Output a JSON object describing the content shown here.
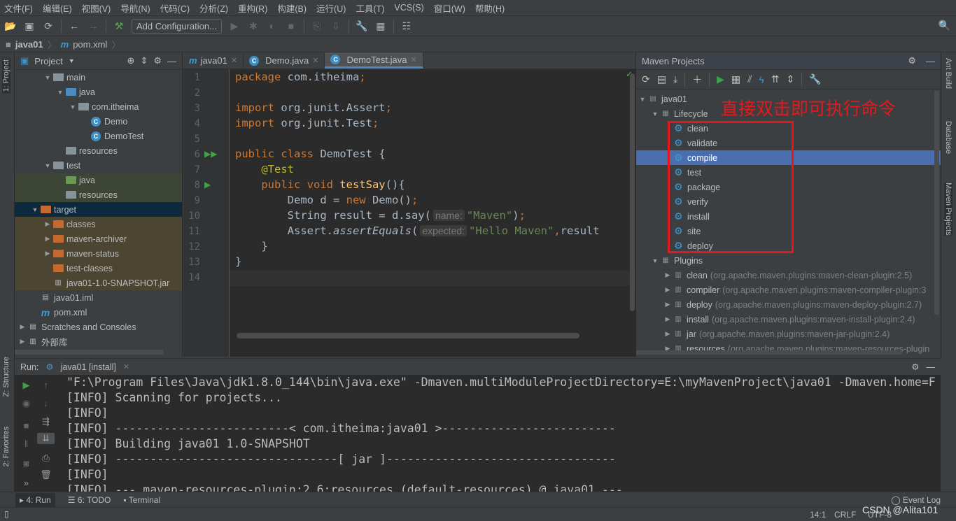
{
  "menu": [
    "文件(F)",
    "编辑(E)",
    "视图(V)",
    "导航(N)",
    "代码(C)",
    "分析(Z)",
    "重构(R)",
    "构建(B)",
    "运行(U)",
    "工具(T)",
    "VCS(S)",
    "窗口(W)",
    "帮助(H)"
  ],
  "toolbar": {
    "add_configuration": "Add Configuration..."
  },
  "breadcrumb": {
    "project": "java01",
    "file": "pom.xml"
  },
  "left_stripe": {
    "project": "1: Project",
    "structure": "Z: Structure",
    "favorites": "2: Favorites"
  },
  "right_stripe": {
    "ant": "Ant Build",
    "database": "Database",
    "maven": "Maven Projects"
  },
  "project_panel": {
    "title": "Project",
    "items": [
      {
        "label": "main",
        "depth": 2,
        "arrow": "open",
        "icon": "folder"
      },
      {
        "label": "java",
        "depth": 3,
        "arrow": "open",
        "icon": "folder-blue"
      },
      {
        "label": "com.itheima",
        "depth": 4,
        "arrow": "open",
        "icon": "folder"
      },
      {
        "label": "Demo",
        "depth": 5,
        "icon": "class"
      },
      {
        "label": "DemoTest",
        "depth": 5,
        "icon": "class"
      },
      {
        "label": "resources",
        "depth": 3,
        "icon": "folder"
      },
      {
        "label": "test",
        "depth": 2,
        "arrow": "open",
        "icon": "folder"
      },
      {
        "label": "java",
        "depth": 3,
        "icon": "folder-green",
        "bg": "test"
      },
      {
        "label": "resources",
        "depth": 3,
        "icon": "folder",
        "bg": "test"
      },
      {
        "label": "target",
        "depth": 1,
        "arrow": "open",
        "icon": "folder-orange",
        "bg": "selected"
      },
      {
        "label": "classes",
        "depth": 2,
        "arrow": "closed",
        "icon": "folder-orange",
        "bg": "excluded"
      },
      {
        "label": "maven-archiver",
        "depth": 2,
        "arrow": "closed",
        "icon": "folder-orange",
        "bg": "excluded"
      },
      {
        "label": "maven-status",
        "depth": 2,
        "arrow": "closed",
        "icon": "folder-orange",
        "bg": "excluded"
      },
      {
        "label": "test-classes",
        "depth": 2,
        "icon": "folder-orange",
        "bg": "excluded"
      },
      {
        "label": "java01-1.0-SNAPSHOT.jar",
        "depth": 2,
        "icon": "jar",
        "bg": "excluded"
      },
      {
        "label": "java01.iml",
        "depth": 1,
        "icon": "iml"
      },
      {
        "label": "pom.xml",
        "depth": 1,
        "icon": "maven"
      },
      {
        "label": "Scratches and Consoles",
        "depth": 0,
        "arrow": "closed",
        "icon": "scratch"
      },
      {
        "label": "外部库",
        "depth": 0,
        "arrow": "closed",
        "icon": "library"
      }
    ]
  },
  "editor": {
    "tabs": [
      {
        "label": "java01",
        "icon": "maven",
        "active": false
      },
      {
        "label": "Demo.java",
        "icon": "class",
        "active": false
      },
      {
        "label": "DemoTest.java",
        "icon": "class",
        "active": true
      }
    ],
    "lines": [
      [
        [
          "k",
          "package "
        ],
        [
          "",
          "com.itheima"
        ],
        [
          "k",
          ";"
        ]
      ],
      [],
      [
        [
          "k",
          "import "
        ],
        [
          "",
          "org.junit.Assert"
        ],
        [
          "k",
          ";"
        ]
      ],
      [
        [
          "k",
          "import "
        ],
        [
          "",
          "org.junit.Test"
        ],
        [
          "k",
          ";"
        ]
      ],
      [],
      [
        [
          "k",
          "public class "
        ],
        [
          "",
          "DemoTest {"
        ]
      ],
      [
        [
          "",
          "    "
        ],
        [
          "a",
          "@Test"
        ]
      ],
      [
        [
          "",
          "    "
        ],
        [
          "k",
          "public void "
        ],
        [
          "m",
          "testSay"
        ],
        [
          "",
          "(){"
        ]
      ],
      [
        [
          "",
          "        Demo d = "
        ],
        [
          "k",
          "new "
        ],
        [
          "",
          "Demo()"
        ],
        [
          "k",
          ";"
        ]
      ],
      [
        [
          "",
          "        String result = d.say("
        ],
        [
          "hint",
          "name:"
        ],
        [
          "s",
          "\"Maven\""
        ],
        [
          "",
          ")"
        ],
        [
          "k",
          ";"
        ]
      ],
      [
        [
          "",
          "        Assert."
        ],
        [
          "i",
          "assertEquals"
        ],
        [
          "",
          "("
        ],
        [
          "hint",
          "expected:"
        ],
        [
          "s",
          "\"Hello Maven\""
        ],
        [
          "k",
          ","
        ],
        [
          "",
          "result"
        ]
      ],
      [
        [
          "",
          "    }"
        ]
      ],
      [
        [
          "",
          "}"
        ]
      ],
      []
    ]
  },
  "maven_panel": {
    "title": "Maven Projects",
    "project": "java01",
    "lifecycle_label": "Lifecycle",
    "lifecycle": [
      "clean",
      "validate",
      "compile",
      "test",
      "package",
      "verify",
      "install",
      "site",
      "deploy"
    ],
    "selected": "compile",
    "plugins_label": "Plugins",
    "plugins": [
      {
        "name": "clean",
        "coords": "(org.apache.maven.plugins:maven-clean-plugin:2.5)"
      },
      {
        "name": "compiler",
        "coords": "(org.apache.maven.plugins:maven-compiler-plugin:3"
      },
      {
        "name": "deploy",
        "coords": "(org.apache.maven.plugins:maven-deploy-plugin:2.7)"
      },
      {
        "name": "install",
        "coords": "(org.apache.maven.plugins:maven-install-plugin:2.4)"
      },
      {
        "name": "jar",
        "coords": "(org.apache.maven.plugins:maven-jar-plugin:2.4)"
      },
      {
        "name": "resources",
        "coords": "(org.apache.maven.plugins:maven-resources-plugin"
      }
    ],
    "annotation": "直接双击即可执行命令",
    "annotation_color": "#e8171c"
  },
  "run_panel": {
    "label": "Run:",
    "tab": "java01 [install]",
    "lines": [
      "\"F:\\Program Files\\Java\\jdk1.8.0_144\\bin\\java.exe\" -Dmaven.multiModuleProjectDirectory=E:\\myMavenProject\\java01 -Dmaven.home=F",
      "[INFO] Scanning for projects...",
      "[INFO]",
      "[INFO] -------------------------< com.itheima:java01 >-------------------------",
      "[INFO] Building java01 1.0-SNAPSHOT",
      "[INFO] --------------------------------[ jar ]---------------------------------",
      "[INFO]",
      "[INFO] --- maven-resources-plugin:2.6:resources (default-resources) @ java01 ---"
    ]
  },
  "bottom_bar": {
    "run": "4: Run",
    "todo": "6: TODO",
    "terminal": "Terminal",
    "event_log": "Event Log"
  },
  "status_bar": {
    "position": "14:1",
    "line_sep": "CRLF",
    "encoding": "UTF-8",
    "watermark": "CSDN @Alita101"
  },
  "colors": {
    "accent": "#4a88c7",
    "selection": "#4b6eaf",
    "keyword": "#cc7832",
    "string": "#6a8759",
    "annotation": "#bbb529"
  }
}
